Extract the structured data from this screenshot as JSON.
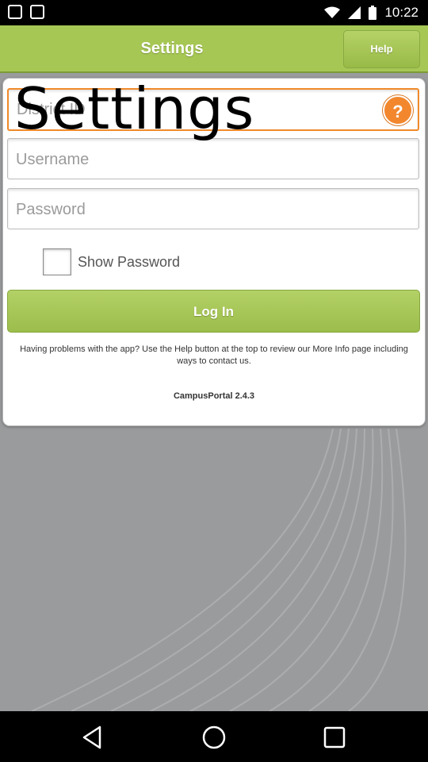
{
  "status_bar": {
    "time": "10:22"
  },
  "header": {
    "title": "Settings",
    "help_label": "Help"
  },
  "overlay": {
    "text": "Settings"
  },
  "form": {
    "district_placeholder": "District ID",
    "info_icon_glyph": "?",
    "username_placeholder": "Username",
    "password_placeholder": "Password",
    "show_password_label": "Show Password",
    "show_password_checked": false,
    "login_label": "Log In"
  },
  "help_text": "Having problems with the app? Use the Help button at the top to review our More Info page including ways to contact us.",
  "version": "CampusPortal 2.4.3",
  "colors": {
    "accent_green": "#a6c754",
    "warning_orange": "#f08a2a",
    "background_gray": "#9a9b9d"
  },
  "icons": [
    "notification-icon",
    "notification-icon",
    "wifi-icon",
    "signal-icon",
    "battery-icon",
    "info-icon",
    "back-icon",
    "home-icon",
    "recents-icon"
  ]
}
